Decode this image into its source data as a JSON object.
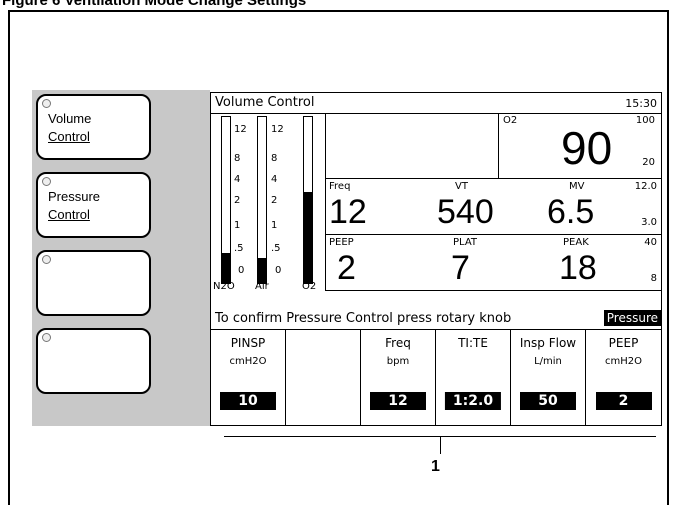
{
  "caption": "Figure 6 Ventilation Mode Change Settings",
  "side_buttons": [
    {
      "line1": "Volume",
      "line2": "Control"
    },
    {
      "line1": "Pressure",
      "line2": "Control"
    },
    {
      "line1": "",
      "line2": ""
    },
    {
      "line1": "",
      "line2": ""
    }
  ],
  "header": {
    "title": "Volume Control",
    "time": "15:30"
  },
  "gas_bars": {
    "ticks": [
      "12",
      "8",
      "4",
      "2",
      "1",
      ".5",
      "0"
    ],
    "labels": [
      "N2O",
      "Air",
      "O2"
    ],
    "levels": [
      0.18,
      0.15,
      0.55
    ]
  },
  "o2": {
    "label": "O2",
    "value": "90",
    "high": "100",
    "low": "20"
  },
  "row1": {
    "freq_label": "Freq",
    "freq": "12",
    "vt_label": "VT",
    "vt": "540",
    "mv_label": "MV",
    "mv": "6.5",
    "mv_high": "12.0",
    "mv_low": "3.0"
  },
  "row2": {
    "peep_label": "PEEP",
    "peep": "2",
    "plat_label": "PLAT",
    "plat": "7",
    "peak_label": "PEAK",
    "peak": "18",
    "peak_high": "40",
    "peak_low": "8"
  },
  "prompt": {
    "text": "To confirm Pressure Control press rotary knob",
    "mode": "Pressure"
  },
  "keys": [
    {
      "name": "PINSP",
      "unit": "cmH2O",
      "value": "10"
    },
    {
      "name": "",
      "unit": "",
      "value": ""
    },
    {
      "name": "Freq",
      "unit": "bpm",
      "value": "12"
    },
    {
      "name": "TI:TE",
      "unit": "",
      "value": "1:2.0"
    },
    {
      "name": "Insp Flow",
      "unit": "L/min",
      "value": "50"
    },
    {
      "name": "PEEP",
      "unit": "cmH2O",
      "value": "2"
    }
  ],
  "callout": "1"
}
